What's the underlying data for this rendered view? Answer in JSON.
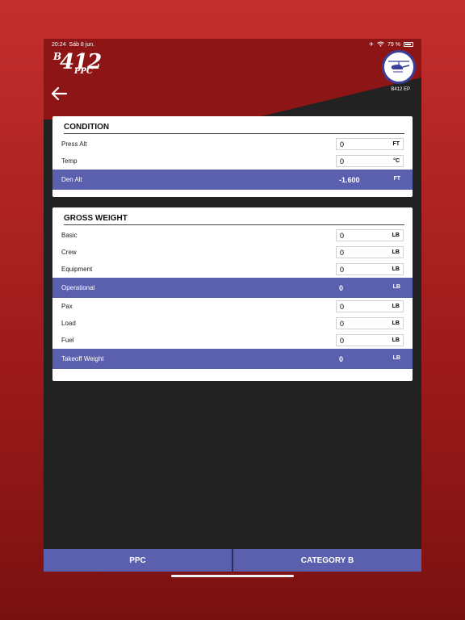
{
  "status": {
    "time": "20:24",
    "date": "Sáb 8 jun.",
    "battery": "79 %"
  },
  "logo": {
    "b": "B",
    "num": "412",
    "ppc": "PPC"
  },
  "aircraft": {
    "label": "B412 EP"
  },
  "condition": {
    "title": "CONDITION",
    "press_alt": {
      "label": "Press Alt",
      "value": "0",
      "unit": "FT"
    },
    "temp": {
      "label": "Temp",
      "value": "0",
      "unit": "°C"
    },
    "den_alt": {
      "label": "Den Alt",
      "value": "-1.600",
      "unit": "FT"
    }
  },
  "gross_weight": {
    "title": "GROSS WEIGHT",
    "basic": {
      "label": "Basic",
      "value": "0",
      "unit": "LB"
    },
    "crew": {
      "label": "Crew",
      "value": "0",
      "unit": "LB"
    },
    "equipment": {
      "label": "Equipment",
      "value": "0",
      "unit": "LB"
    },
    "operational": {
      "label": "Operational",
      "value": "0",
      "unit": "LB"
    },
    "pax": {
      "label": "Pax",
      "value": "0",
      "unit": "LB"
    },
    "load": {
      "label": "Load",
      "value": "0",
      "unit": "LB"
    },
    "fuel": {
      "label": "Fuel",
      "value": "0",
      "unit": "LB"
    },
    "takeoff": {
      "label": "Takeoff Weight",
      "value": "0",
      "unit": "LB"
    }
  },
  "tabs": {
    "ppc": "PPC",
    "category": "CATEGORY B"
  },
  "colors": {
    "accent": "#5a5fae",
    "header": "#8e1515",
    "dark": "#222222"
  }
}
